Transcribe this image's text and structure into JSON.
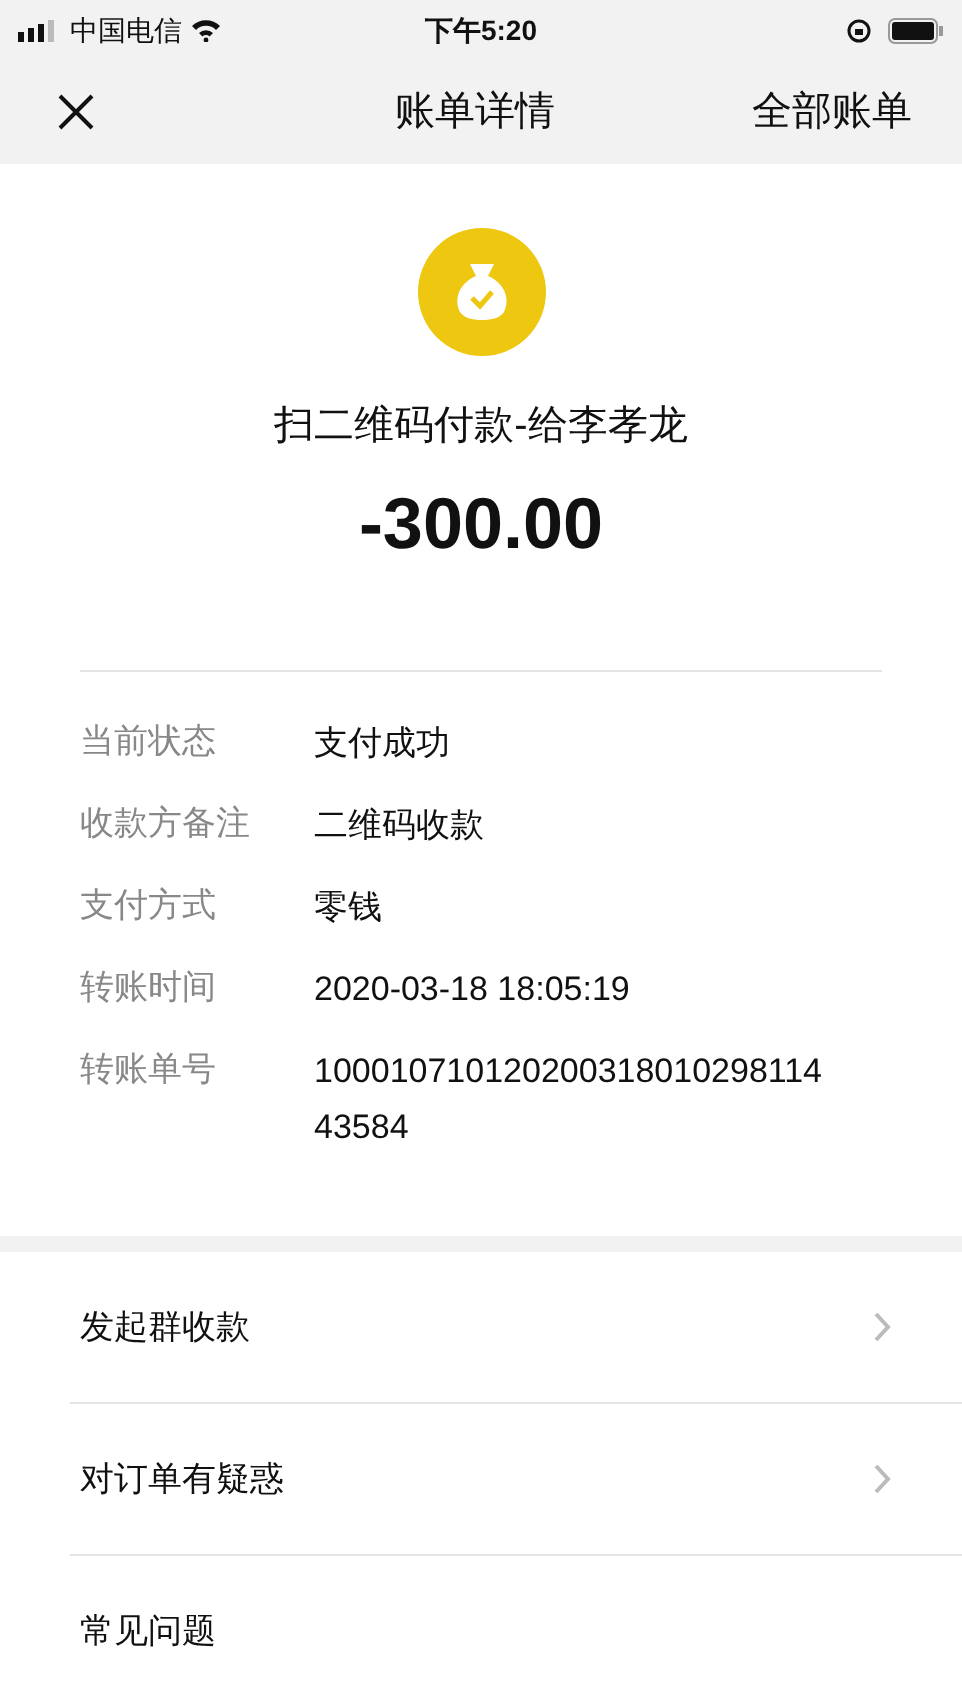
{
  "status_bar": {
    "carrier": "中国电信",
    "time": "下午5:20"
  },
  "header": {
    "title": "账单详情",
    "action": "全部账单"
  },
  "summary": {
    "title": "扫二维码付款-给李孝龙",
    "amount": "-300.00"
  },
  "details": [
    {
      "label": "当前状态",
      "value": "支付成功"
    },
    {
      "label": "收款方备注",
      "value": "二维码收款"
    },
    {
      "label": "支付方式",
      "value": "零钱"
    },
    {
      "label": "转账时间",
      "value": "2020-03-18 18:05:19"
    },
    {
      "label": "转账单号",
      "value": "10001071012020031801029811443584"
    }
  ],
  "menu": [
    {
      "label": "发起群收款"
    },
    {
      "label": "对订单有疑惑"
    },
    {
      "label": "常见问题"
    }
  ]
}
